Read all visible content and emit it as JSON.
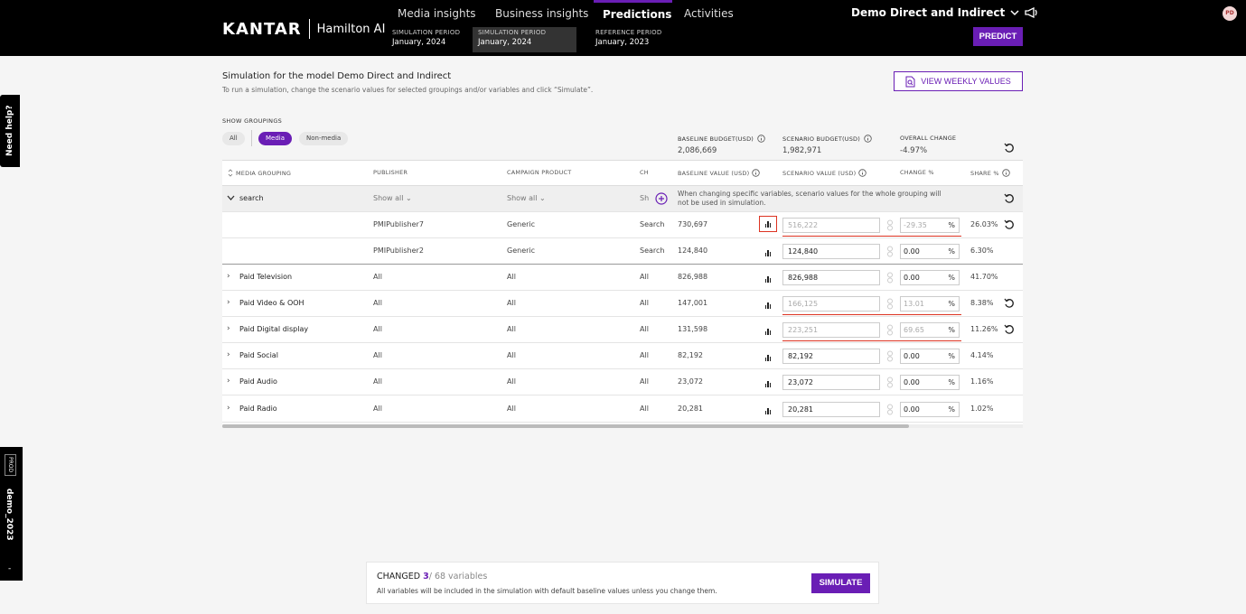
{
  "header": {
    "logo": "KANTAR",
    "app_name": "Hamilton AI",
    "tabs": [
      "Media insights",
      "Business insights",
      "Predictions",
      "Activities"
    ],
    "active_tab": "Predictions",
    "periods": [
      {
        "label": "SIMULATION PERIOD",
        "value": "January, 2024"
      },
      {
        "label": "SIMULATION PERIOD",
        "value": "January, 2024"
      },
      {
        "label": "REFERENCE PERIOD",
        "value": "January, 2023"
      }
    ],
    "model_name": "Demo Direct and Indirect",
    "predict_label": "PREDICT",
    "avatar_initials": "PD"
  },
  "side": {
    "need_help": "Need help?",
    "env_badge": "PROD",
    "env_name": "demo_2023",
    "env_dash": "-"
  },
  "page": {
    "title": "Simulation for the model Demo Direct and Indirect",
    "subtitle": "To run a simulation, change the scenario values for selected groupings and/or variables and click “Simulate”.",
    "weekly_label": "VIEW WEEKLY VALUES"
  },
  "groupings": {
    "label": "SHOW GROUPINGS",
    "chips": [
      "All",
      "Media",
      "Non-media"
    ],
    "active": "Media"
  },
  "budget": {
    "baseline_label": "BASELINE BUDGET(USD)",
    "baseline_value": "2,086,669",
    "scenario_label": "SCENARIO BUDGET(USD)",
    "scenario_value": "1,982,971",
    "overall_label": "OVERALL CHANGE",
    "overall_value": "-4.97%"
  },
  "table": {
    "columns": [
      "MEDIA GROUPING",
      "PUBLISHER",
      "CAMPAIGN PRODUCT",
      "CH",
      "BASELINE VALUE (USD)",
      "SCENARIO VALUE (USD)",
      "CHANGE %",
      "SHARE %"
    ],
    "group_row": {
      "name": "search",
      "publisher": "Show all",
      "product": "Show all",
      "channel": "Sh",
      "note": "When changing specific variables, scenario values for the whole grouping will not be used in simulation."
    },
    "rows": [
      {
        "grouping": "",
        "publisher": "PMIPublisher7",
        "product": "Generic",
        "channel": "Search",
        "baseline": "730,697",
        "scenario": "516,222",
        "change": "-29.35",
        "share": "26.03%",
        "dim": true
      },
      {
        "grouping": "",
        "publisher": "PMIPublisher2",
        "product": "Generic",
        "channel": "Search",
        "baseline": "124,840",
        "scenario": "124,840",
        "change": "0.00",
        "share": "6.30%",
        "dim": false
      },
      {
        "grouping": "Paid Television",
        "publisher": "All",
        "product": "All",
        "channel": "All",
        "baseline": "826,988",
        "scenario": "826,988",
        "change": "0.00",
        "share": "41.70%",
        "dim": false
      },
      {
        "grouping": "Paid Video & OOH",
        "publisher": "All",
        "product": "All",
        "channel": "All",
        "baseline": "147,001",
        "scenario": "166,125",
        "change": "13.01",
        "share": "8.38%",
        "dim": true
      },
      {
        "grouping": "Paid Digital display",
        "publisher": "All",
        "product": "All",
        "channel": "All",
        "baseline": "131,598",
        "scenario": "223,251",
        "change": "69.65",
        "share": "11.26%",
        "dim": true
      },
      {
        "grouping": "Paid Social",
        "publisher": "All",
        "product": "All",
        "channel": "All",
        "baseline": "82,192",
        "scenario": "82,192",
        "change": "0.00",
        "share": "4.14%",
        "dim": false
      },
      {
        "grouping": "Paid Audio",
        "publisher": "All",
        "product": "All",
        "channel": "All",
        "baseline": "23,072",
        "scenario": "23,072",
        "change": "0.00",
        "share": "1.16%",
        "dim": false
      },
      {
        "grouping": "Paid Radio",
        "publisher": "All",
        "product": "All",
        "channel": "All",
        "baseline": "20,281",
        "scenario": "20,281",
        "change": "0.00",
        "share": "1.02%",
        "dim": false
      }
    ],
    "percent_symbol": "%"
  },
  "bottom": {
    "changed_label": "CHANGED",
    "changed_count": "3",
    "changed_total": "/ 68 variables",
    "note": "All variables will be included in the simulation with default baseline values unless you change them.",
    "simulate_label": "SIMULATE"
  }
}
